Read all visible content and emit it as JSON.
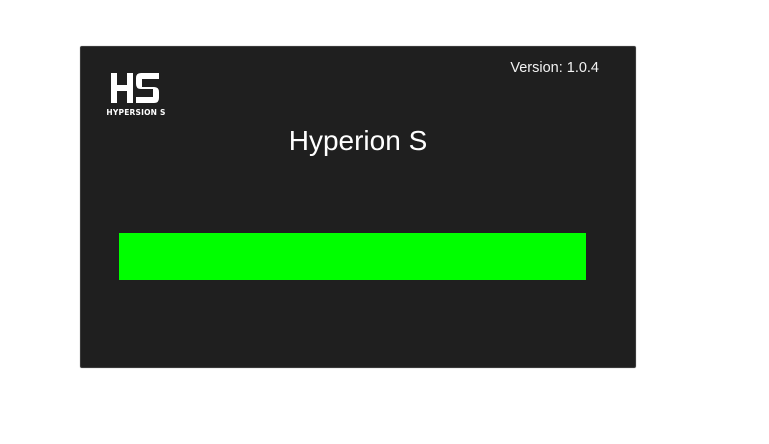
{
  "splash": {
    "logo": {
      "mark": "HS",
      "caption": "HYPERSION S"
    },
    "version_label": "Version:",
    "version_value": "1.0.4",
    "title": "Hyperion S",
    "progress": {
      "fraction": 1.0,
      "color": "#00ff00"
    }
  }
}
